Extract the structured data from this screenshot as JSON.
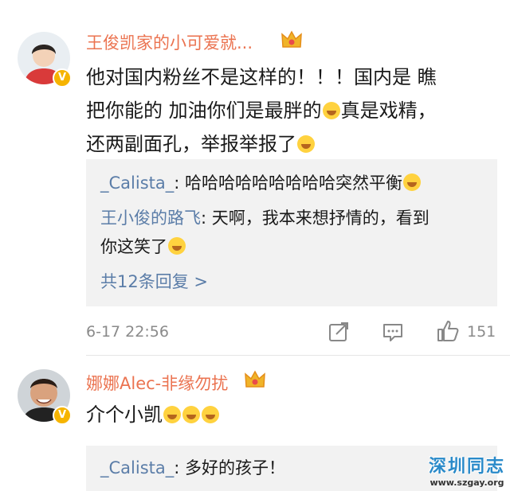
{
  "comments": [
    {
      "username": "王俊凯家的小可爱就...",
      "text_lines": [
        "他对国内粉丝不是这样的！！！国内是 瞧",
        "把你能的 加油你们是最胖的",
        "真是戏精，",
        "还两副面孔，举报举报了"
      ],
      "replies": [
        {
          "user": "_Calista_",
          "text": ": 哈哈哈哈哈哈哈哈哈突然平衡"
        },
        {
          "user": "王小俊的路飞",
          "text": ": 天啊，我本来想抒情的，看到"
        },
        {
          "user": "",
          "text": "你这笑了"
        }
      ],
      "more_replies": "共12条回复 >",
      "time": "6-17 22:56",
      "likes": "151"
    },
    {
      "username": "娜娜Alec-非缘勿扰",
      "text": "介个小凯",
      "replies": [
        {
          "user": "_Calista_",
          "text": ": 多好的孩子！"
        }
      ]
    }
  ],
  "watermark": {
    "title": "深圳同志",
    "url": "www.szgay.org"
  },
  "colors": {
    "username": "#eb7350",
    "reply_user": "#5b7da8",
    "reply_bg": "#f2f2f2",
    "badge": "#f6b400"
  }
}
